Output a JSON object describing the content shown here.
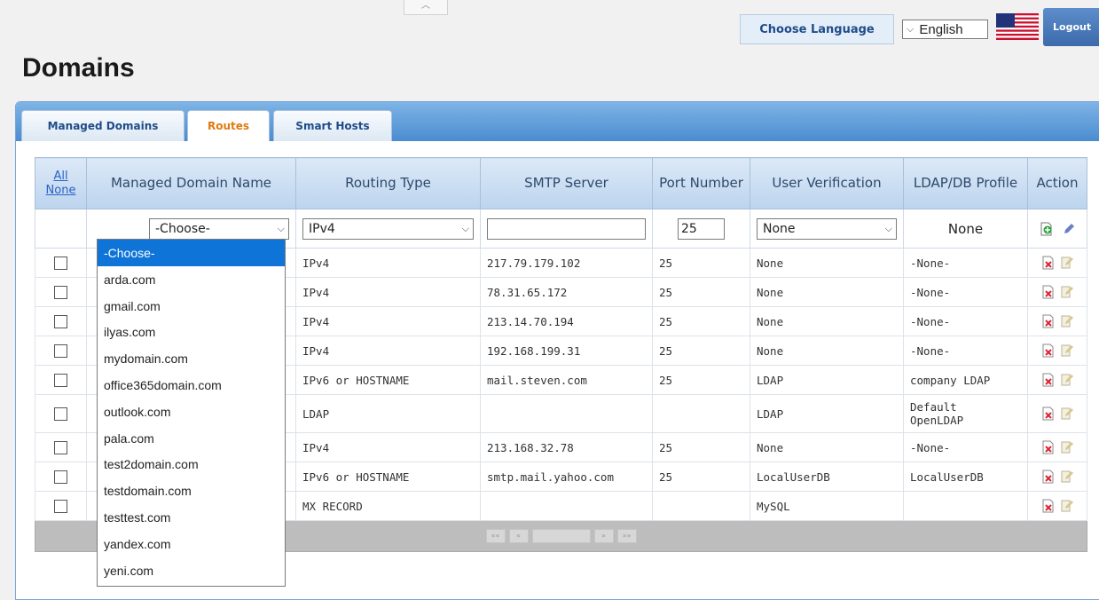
{
  "header": {
    "choose_language_label": "Choose Language",
    "language_value": "English",
    "logout_label": "Logout",
    "page_title": "Domains"
  },
  "tabs": [
    {
      "label": "Managed Domains",
      "active": false
    },
    {
      "label": "Routes",
      "active": true
    },
    {
      "label": "Smart Hosts",
      "active": false
    }
  ],
  "columns": {
    "all": "All",
    "none": "None",
    "managed_domain_name": "Managed Domain Name",
    "routing_type": "Routing Type",
    "smtp_server": "SMTP Server",
    "port_number": "Port Number",
    "user_verification": "User Verification",
    "ldap_db_profile": "LDAP/DB Profile",
    "action": "Action"
  },
  "filter": {
    "domain_select": "-Choose-",
    "routing_type_select": "IPv4",
    "smtp_server_value": "",
    "port_value": "25",
    "user_verification_select": "None",
    "ldap_profile": "None"
  },
  "rows": [
    {
      "routing_type": "IPv4",
      "smtp_server": "217.79.179.102",
      "port": "25",
      "user_verification": "None",
      "profile": "-None-"
    },
    {
      "routing_type": "IPv4",
      "smtp_server": "78.31.65.172",
      "port": "25",
      "user_verification": "None",
      "profile": "-None-"
    },
    {
      "routing_type": "IPv4",
      "smtp_server": "213.14.70.194",
      "port": "25",
      "user_verification": "None",
      "profile": "-None-"
    },
    {
      "routing_type": "IPv4",
      "smtp_server": "192.168.199.31",
      "port": "25",
      "user_verification": "None",
      "profile": "-None-"
    },
    {
      "routing_type": "IPv6 or HOSTNAME",
      "smtp_server": "mail.steven.com",
      "port": "25",
      "user_verification": "LDAP",
      "profile": "company LDAP"
    },
    {
      "routing_type": "LDAP",
      "smtp_server": "",
      "port": "",
      "user_verification": "LDAP",
      "profile_line1": "Default",
      "profile_line2": "OpenLDAP"
    },
    {
      "routing_type": "IPv4",
      "smtp_server": "213.168.32.78",
      "port": "25",
      "user_verification": "None",
      "profile": "-None-"
    },
    {
      "routing_type": "IPv6 or HOSTNAME",
      "smtp_server": "smtp.mail.yahoo.com",
      "port": "25",
      "user_verification": "LocalUserDB",
      "profile": "LocalUserDB"
    },
    {
      "routing_type": "MX RECORD",
      "smtp_server": "",
      "port": "",
      "user_verification": "MySQL",
      "profile": ""
    }
  ],
  "pager": {
    "first": "««",
    "prev": "«",
    "next": "»",
    "last": "»»"
  },
  "domain_dropdown": {
    "selected_index": 0,
    "options": [
      "-Choose-",
      "arda.com",
      "gmail.com",
      "ilyas.com",
      "mydomain.com",
      "office365domain.com",
      "outlook.com",
      "pala.com",
      "test2domain.com",
      "testdomain.com",
      "testtest.com",
      "yandex.com",
      "yeni.com"
    ]
  },
  "icons": {
    "add": "add-icon",
    "edit_pencil": "pencil-icon",
    "delete": "delete-icon",
    "edit": "edit-icon",
    "flag": "us-flag-icon"
  },
  "colors": {
    "tab_active_text": "#e07a10",
    "link": "#2a63c8",
    "dropdown_selected": "#0f74d8"
  }
}
